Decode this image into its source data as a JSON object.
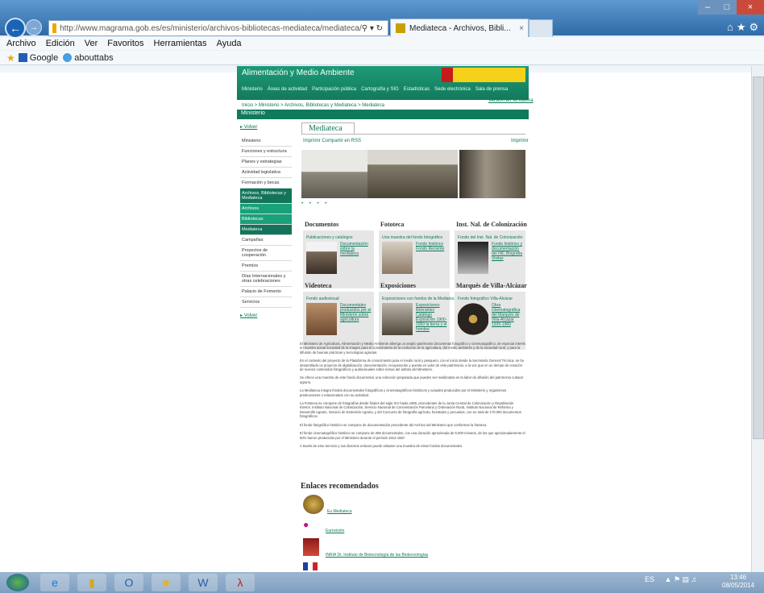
{
  "browser": {
    "url": "http://www.magrama.gob.es/es/ministerio/archivos-bibliotecas-mediateca/mediateca/",
    "tab_title": "Mediateca - Archivos, Bibli...",
    "menu": [
      "Archivo",
      "Edición",
      "Ver",
      "Favoritos",
      "Herramientas",
      "Ayuda"
    ],
    "favorites": [
      "Google",
      "abouttabs"
    ]
  },
  "site": {
    "title": "Alimentación y Medio Ambiente",
    "topnav": [
      "Ministerio",
      "Áreas de actividad",
      "Participación pública",
      "Cartografía y SIG",
      "Estadísticas",
      "Sede electrónica",
      "Sala de prensa"
    ],
    "breadcrumb": "Inicio > Ministerio > Archivos, Bibliotecas y Mediateca > Mediateca",
    "version_link": "Versión en su idioma",
    "section": "Ministerio"
  },
  "sidebar": {
    "top_link": "Volver",
    "bottom_link": "Volver",
    "items": [
      {
        "label": "Ministerio",
        "style": ""
      },
      {
        "label": "Funciones y estructura",
        "style": ""
      },
      {
        "label": "Planes y estrategias",
        "style": ""
      },
      {
        "label": "Actividad legislativa",
        "style": ""
      },
      {
        "label": "Formación y becas",
        "style": ""
      },
      {
        "label": "Archivos, Bibliotecas y Mediateca",
        "style": "dk"
      },
      {
        "label": "Archivos",
        "style": "lt"
      },
      {
        "label": "Bibliotecas",
        "style": "lt"
      },
      {
        "label": "Mediateca",
        "style": "dk"
      },
      {
        "label": "Campañas",
        "style": ""
      },
      {
        "label": "Proyectos de cooperación",
        "style": ""
      },
      {
        "label": "Premios",
        "style": ""
      },
      {
        "label": "Días Internacionales y otras celebraciones",
        "style": ""
      },
      {
        "label": "Palacio de Fomento",
        "style": ""
      },
      {
        "label": "Servicios",
        "style": ""
      }
    ]
  },
  "main": {
    "tab_label": "Mediateca",
    "tools": "Imprimir   Compartir en RSS",
    "print_label": "Imprimir",
    "dots": "• • • •",
    "cards": [
      {
        "title": "Documentos",
        "sub": "Publicaciones y catálogos",
        "link": "Documentación sobre la mediateca"
      },
      {
        "title": "Fototeca",
        "sub": "Una muestra del fondo fotográfico",
        "link": "Fondo histórico Fondo Reciente"
      },
      {
        "title": "Inst. Nal. de Colonización",
        "sub": "Fondo del Inst. Nal. de Colonización",
        "link": "Fondo histórico y documentación del INC Biografía Visitas"
      },
      {
        "title": "Videoteca",
        "sub": "Fondo audiovisual",
        "link": "Documentales producidos por el Ministerio sobre agricultura"
      },
      {
        "title": "Exposiciones",
        "sub": "Exposiciones con fondos de la Mediateca",
        "link": "Exposiciones itinerantes Catálogo Exposición 1900-1950 la tierra y el hombre"
      },
      {
        "title": "Marqués de Villa-Alcázar",
        "sub": "Fondo fotográfico Villa-Alcázar",
        "link": "Obra cinematográfica del Marqués de Villa-Alcázar 1935-1960"
      }
    ],
    "paragraphs": [
      "El Ministerio de Agricultura, Alimentación y Medio Ambiente alberga un amplio patrimonio documental fotográfico y cinematográfico, de especial interés en nuestra actual sociedad de la imagen para el conocimiento de la evolución de la agricultura, del medio ambiente y de la sociedad rural, y para la difusión de buenas prácticas y tecnologías agrarias.",
      "En el contexto del proyecto de la Plataforma de conocimiento para el medio rural y pesquero, con el inicio desde la Secretaría General Técnica, se ha desarrollado un proyecto de digitalización, documentación, recuperación y puesta en valor de este patrimonio, a la vez que en un tiempo de creación de nuevos contenidos fotográficos y audiovisuales sobre temas del ámbito del Ministerio.",
      "Se ofrece una muestra de este fondo documental, una colección preparada que pueden ser reutilizados en la labor de difusión del patrimonio cultural agrario.",
      "La Mediateca integra fondos documentales fotográficos y cinematográficos históricos y actuales producidos por el Ministerio y organismos predecesores o relacionados con su actividad.",
      "La Fototeca se compone de fotografías desde finales del siglo XIX hasta 1990, procedentes de la Junta Central de Colonización y Repoblación Interior, Instituto Nacional de Colonización, Servicio Nacional de Concentración Parcelaria y Ordenación Rural, Instituto Nacional de Reforma y Desarrollo Agrario, Servicio de Extensión Agraria, y del Concurso de fotografía agrícola, forestales y pecuarias, con un total de 170.000 documentos fotográficos.",
      "El fondo fotográfico histórico se compone de documentación procedente del Archivo del Ministerio que conforman la fototeca.",
      "El fondo cinematográfico histórico se compone de 286 documentales, con una duración aproximada de 5.000 minutos, de los que aproximadamente el 50% fueron producidos por el Ministerio durante el período 1914-1967.",
      "A través de este Servicio y sus diversos enlaces puede visitarse una muestra de estos fondos documentales."
    ],
    "enlaces_title": "Enlaces recomendados",
    "enlaces": [
      {
        "label": "Eu Mediateca"
      },
      {
        "label": "Eurovisión"
      },
      {
        "label": "INRIA Dr. Instituto de Biotecnología de las Biotecnologías"
      }
    ]
  },
  "taskbar": {
    "apps": [
      "ie",
      "explorer",
      "outlook",
      "folder",
      "word",
      "acrobat"
    ],
    "tray_lang": "ES",
    "time": "13:46",
    "date": "08/05/2014"
  }
}
